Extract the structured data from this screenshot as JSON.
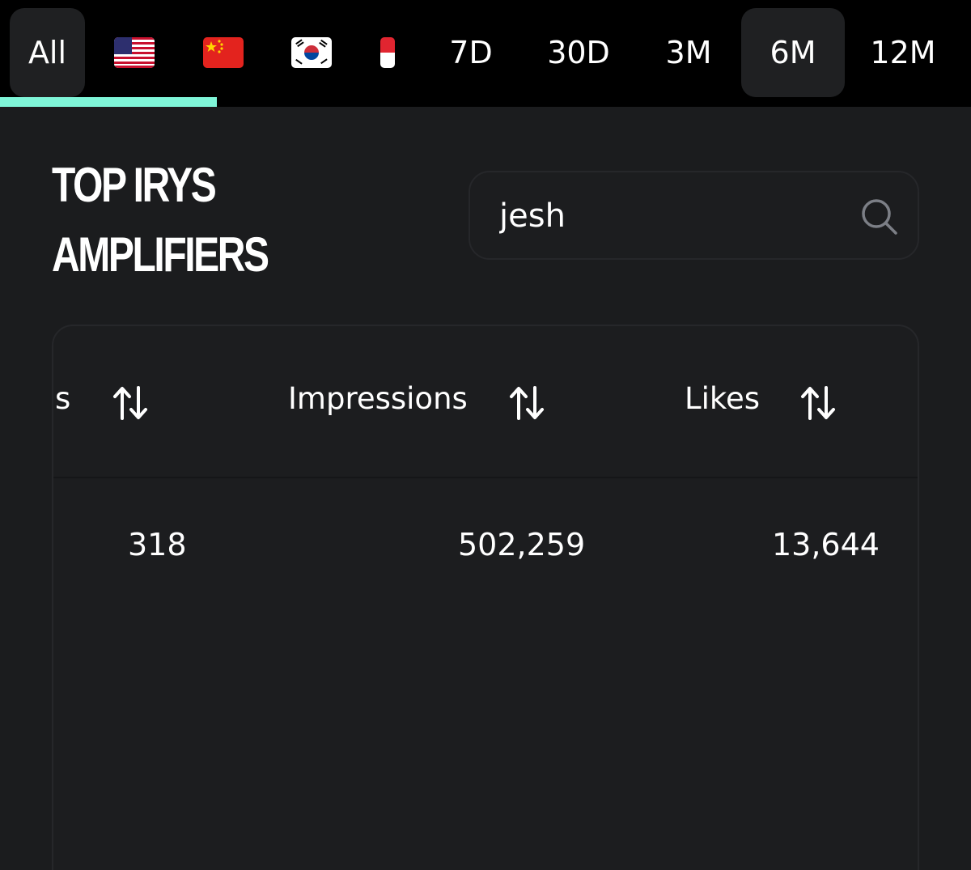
{
  "tabs": {
    "all": "All",
    "d7": "7D",
    "d30": "30D",
    "m3": "3M",
    "m6": "6M",
    "m12": "12M"
  },
  "flags": [
    "us-flag-icon",
    "china-flag-icon",
    "south-korea-flag-icon",
    "indonesia-flag-icon"
  ],
  "title": {
    "line1": "TOP IRYS",
    "line2": "AMPLIFIERS"
  },
  "search": {
    "value": "jesh"
  },
  "table": {
    "columns": [
      "s",
      "Impressions",
      "Likes"
    ],
    "rows": [
      [
        "318",
        "502,259",
        "13,644"
      ]
    ]
  },
  "colors": {
    "accent": "#7ff5d8",
    "background": "#1b1c1e",
    "topbar": "#000000"
  }
}
